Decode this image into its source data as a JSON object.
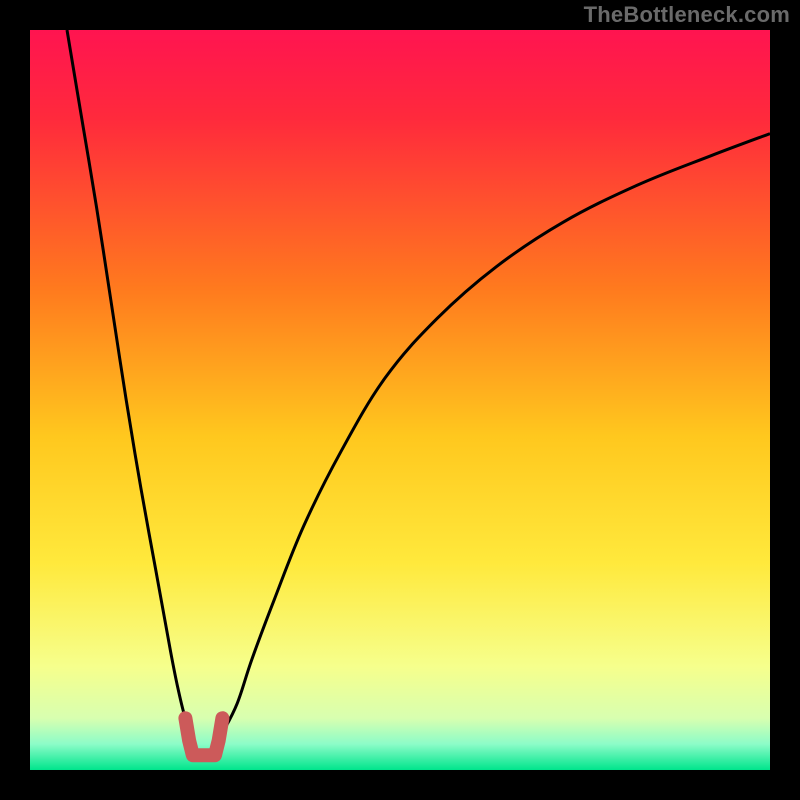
{
  "watermark": "TheBottleneck.com",
  "chart_data": {
    "type": "line",
    "title": "",
    "xlabel": "",
    "ylabel": "",
    "xlim": [
      0,
      100
    ],
    "ylim": [
      0,
      100
    ],
    "gradient_stops": [
      {
        "pos": 0,
        "color": "#ff1450"
      },
      {
        "pos": 0.12,
        "color": "#ff2a3c"
      },
      {
        "pos": 0.35,
        "color": "#ff7a1e"
      },
      {
        "pos": 0.55,
        "color": "#ffc81e"
      },
      {
        "pos": 0.72,
        "color": "#ffe93c"
      },
      {
        "pos": 0.86,
        "color": "#f6ff8c"
      },
      {
        "pos": 0.93,
        "color": "#d8ffb0"
      },
      {
        "pos": 0.965,
        "color": "#8cfcc8"
      },
      {
        "pos": 1.0,
        "color": "#00e58c"
      }
    ],
    "series": [
      {
        "name": "left-branch",
        "x": [
          5,
          7,
          9,
          11,
          13,
          15,
          17,
          19,
          20,
          21,
          22
        ],
        "values": [
          100,
          88,
          76,
          63,
          50,
          38,
          27,
          16,
          11,
          7,
          5
        ]
      },
      {
        "name": "right-branch",
        "x": [
          26,
          28,
          30,
          33,
          37,
          42,
          48,
          55,
          63,
          72,
          82,
          92,
          100
        ],
        "values": [
          5,
          9,
          15,
          23,
          33,
          43,
          53,
          61,
          68,
          74,
          79,
          83,
          86
        ]
      }
    ],
    "notch": {
      "name": "minimum-notch",
      "color": "#cc5a5a",
      "x": [
        21,
        21.5,
        22,
        23,
        24,
        25,
        25.5,
        26
      ],
      "values": [
        7,
        4,
        2,
        2,
        2,
        2,
        4,
        7
      ]
    }
  }
}
